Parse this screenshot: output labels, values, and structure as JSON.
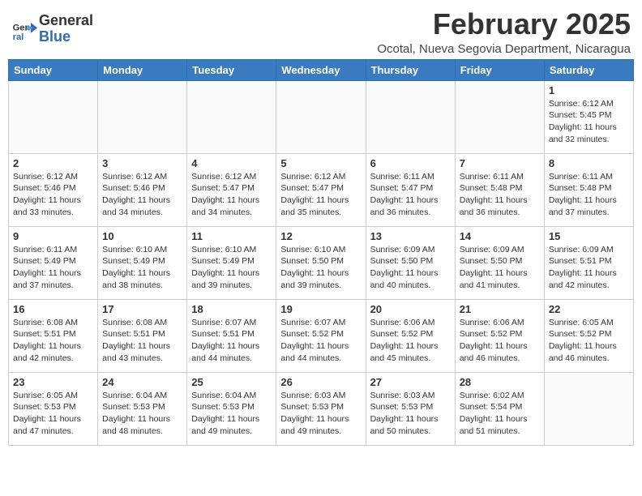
{
  "logo": {
    "general": "General",
    "blue": "Blue"
  },
  "title": {
    "month_year": "February 2025",
    "location": "Ocotal, Nueva Segovia Department, Nicaragua"
  },
  "weekdays": [
    "Sunday",
    "Monday",
    "Tuesday",
    "Wednesday",
    "Thursday",
    "Friday",
    "Saturday"
  ],
  "weeks": [
    [
      {
        "day": "",
        "info": ""
      },
      {
        "day": "",
        "info": ""
      },
      {
        "day": "",
        "info": ""
      },
      {
        "day": "",
        "info": ""
      },
      {
        "day": "",
        "info": ""
      },
      {
        "day": "",
        "info": ""
      },
      {
        "day": "1",
        "info": "Sunrise: 6:12 AM\nSunset: 5:45 PM\nDaylight: 11 hours\nand 32 minutes."
      }
    ],
    [
      {
        "day": "2",
        "info": "Sunrise: 6:12 AM\nSunset: 5:46 PM\nDaylight: 11 hours\nand 33 minutes."
      },
      {
        "day": "3",
        "info": "Sunrise: 6:12 AM\nSunset: 5:46 PM\nDaylight: 11 hours\nand 34 minutes."
      },
      {
        "day": "4",
        "info": "Sunrise: 6:12 AM\nSunset: 5:47 PM\nDaylight: 11 hours\nand 34 minutes."
      },
      {
        "day": "5",
        "info": "Sunrise: 6:12 AM\nSunset: 5:47 PM\nDaylight: 11 hours\nand 35 minutes."
      },
      {
        "day": "6",
        "info": "Sunrise: 6:11 AM\nSunset: 5:47 PM\nDaylight: 11 hours\nand 36 minutes."
      },
      {
        "day": "7",
        "info": "Sunrise: 6:11 AM\nSunset: 5:48 PM\nDaylight: 11 hours\nand 36 minutes."
      },
      {
        "day": "8",
        "info": "Sunrise: 6:11 AM\nSunset: 5:48 PM\nDaylight: 11 hours\nand 37 minutes."
      }
    ],
    [
      {
        "day": "9",
        "info": "Sunrise: 6:11 AM\nSunset: 5:49 PM\nDaylight: 11 hours\nand 37 minutes."
      },
      {
        "day": "10",
        "info": "Sunrise: 6:10 AM\nSunset: 5:49 PM\nDaylight: 11 hours\nand 38 minutes."
      },
      {
        "day": "11",
        "info": "Sunrise: 6:10 AM\nSunset: 5:49 PM\nDaylight: 11 hours\nand 39 minutes."
      },
      {
        "day": "12",
        "info": "Sunrise: 6:10 AM\nSunset: 5:50 PM\nDaylight: 11 hours\nand 39 minutes."
      },
      {
        "day": "13",
        "info": "Sunrise: 6:09 AM\nSunset: 5:50 PM\nDaylight: 11 hours\nand 40 minutes."
      },
      {
        "day": "14",
        "info": "Sunrise: 6:09 AM\nSunset: 5:50 PM\nDaylight: 11 hours\nand 41 minutes."
      },
      {
        "day": "15",
        "info": "Sunrise: 6:09 AM\nSunset: 5:51 PM\nDaylight: 11 hours\nand 42 minutes."
      }
    ],
    [
      {
        "day": "16",
        "info": "Sunrise: 6:08 AM\nSunset: 5:51 PM\nDaylight: 11 hours\nand 42 minutes."
      },
      {
        "day": "17",
        "info": "Sunrise: 6:08 AM\nSunset: 5:51 PM\nDaylight: 11 hours\nand 43 minutes."
      },
      {
        "day": "18",
        "info": "Sunrise: 6:07 AM\nSunset: 5:51 PM\nDaylight: 11 hours\nand 44 minutes."
      },
      {
        "day": "19",
        "info": "Sunrise: 6:07 AM\nSunset: 5:52 PM\nDaylight: 11 hours\nand 44 minutes."
      },
      {
        "day": "20",
        "info": "Sunrise: 6:06 AM\nSunset: 5:52 PM\nDaylight: 11 hours\nand 45 minutes."
      },
      {
        "day": "21",
        "info": "Sunrise: 6:06 AM\nSunset: 5:52 PM\nDaylight: 11 hours\nand 46 minutes."
      },
      {
        "day": "22",
        "info": "Sunrise: 6:05 AM\nSunset: 5:52 PM\nDaylight: 11 hours\nand 46 minutes."
      }
    ],
    [
      {
        "day": "23",
        "info": "Sunrise: 6:05 AM\nSunset: 5:53 PM\nDaylight: 11 hours\nand 47 minutes."
      },
      {
        "day": "24",
        "info": "Sunrise: 6:04 AM\nSunset: 5:53 PM\nDaylight: 11 hours\nand 48 minutes."
      },
      {
        "day": "25",
        "info": "Sunrise: 6:04 AM\nSunset: 5:53 PM\nDaylight: 11 hours\nand 49 minutes."
      },
      {
        "day": "26",
        "info": "Sunrise: 6:03 AM\nSunset: 5:53 PM\nDaylight: 11 hours\nand 49 minutes."
      },
      {
        "day": "27",
        "info": "Sunrise: 6:03 AM\nSunset: 5:53 PM\nDaylight: 11 hours\nand 50 minutes."
      },
      {
        "day": "28",
        "info": "Sunrise: 6:02 AM\nSunset: 5:54 PM\nDaylight: 11 hours\nand 51 minutes."
      },
      {
        "day": "",
        "info": ""
      }
    ]
  ]
}
